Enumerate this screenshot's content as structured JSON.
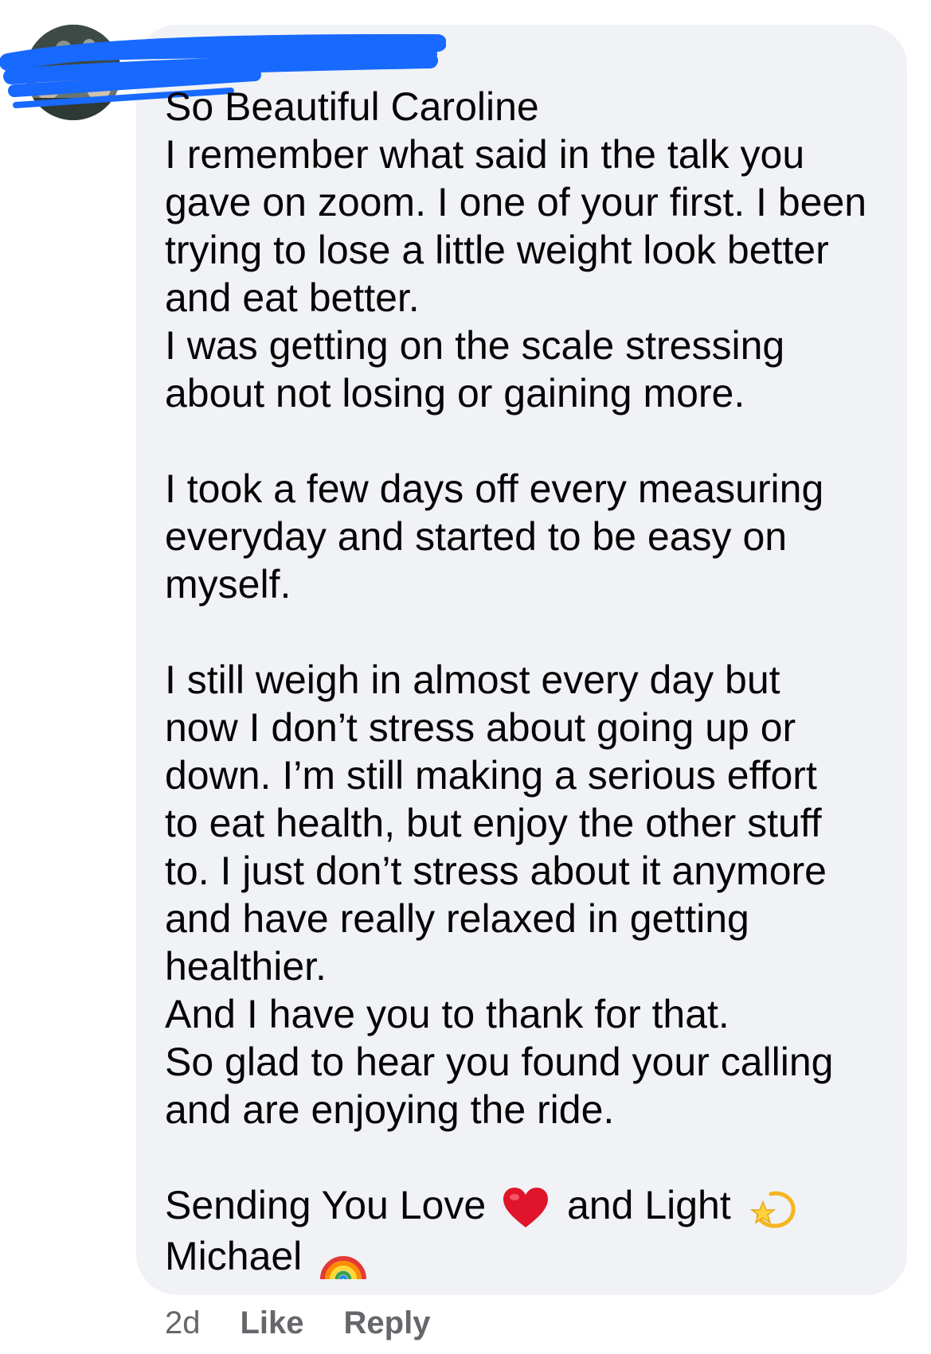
{
  "comment": {
    "author": "",
    "lines": [
      "So Beautiful Caroline",
      "I remember what said in the talk you",
      "gave on zoom. I one of your first. I been",
      "trying to lose a little weight look better",
      "and eat better.",
      "I was getting on the scale stressing",
      "about not losing or gaining more.",
      "",
      "I took a few days off every measuring",
      "everyday and started to be easy on",
      "myself.",
      "",
      "I still weigh in almost every day but",
      "now I don’t stress about going up or",
      "down. I’m still making a serious effort",
      "to eat health, but enjoy the other stuff",
      "to. I just don’t stress about it anymore",
      "and have really relaxed in getting",
      "healthier.",
      "And I have you to thank for that.",
      "So glad to hear you found your calling",
      "and are enjoying the ride.",
      ""
    ],
    "signoff": {
      "part1": "Sending You Love",
      "part2": "and Light",
      "name": "Michael"
    },
    "icons": {
      "heart": "red-heart-icon",
      "star": "dizzy-star-icon",
      "rainbow": "rainbow-icon"
    }
  },
  "meta": {
    "time": "2d",
    "like_label": "Like",
    "reply_label": "Reply"
  },
  "colors": {
    "bubble": "#f0f2f5",
    "text": "#050505",
    "meta": "#65676b",
    "redaction": "#1769ff"
  }
}
